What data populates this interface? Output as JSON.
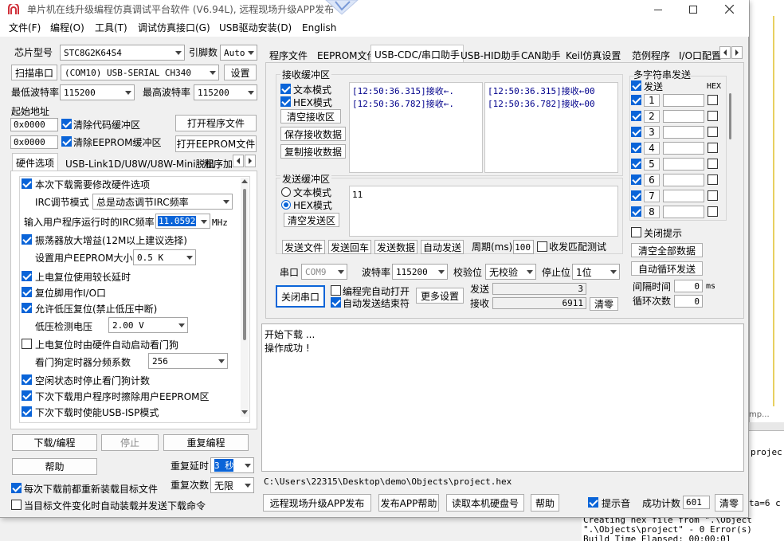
{
  "window": {
    "title": "单片机在线升级编程仿真调试平台软件 (V6.94L), 远程现场升级APP发布",
    "menu": [
      "文件(F)",
      "编程(O)",
      "工具(T)",
      "调试仿真接口(G)",
      "USB驱动安装(D)",
      "English"
    ]
  },
  "left": {
    "chip_label": "芯片型号",
    "chip_value": "STC8G2K64S4",
    "pins_label": "引脚数",
    "pins_value": "Auto",
    "scan_btn": "扫描串口",
    "port_value": "(COM10) USB-SERIAL CH340",
    "settings_btn": "设置",
    "min_baud_label": "最低波特率",
    "min_baud": "115200",
    "max_baud_label": "最高波特率",
    "max_baud": "115200",
    "start_addr_label": "起始地址",
    "addr1": "0x0000",
    "clear_code": "清除代码缓冲区",
    "open_program": "打开程序文件",
    "addr2": "0x0000",
    "clear_eeprom": "清除EEPROM缓冲区",
    "open_eeprom": "打开EEPROM文件",
    "tabs": [
      "硬件选项",
      "USB-Link1D/U8W/U8W-Mini脱机",
      "程序加"
    ],
    "hw": {
      "opt_change": "本次下载需要修改硬件选项",
      "irc_mode_label": "IRC调节模式",
      "irc_mode_value": "总是动态调节IRC频率",
      "freq_label": "输入用户程序运行时的IRC频率",
      "freq_value": "11.0592",
      "freq_unit": "MHz",
      "osc_gain": "振荡器放大增益(12M以上建议选择)",
      "eeprom_size_label": "设置用户EEPROM大小",
      "eeprom_size_value": "0.5 K",
      "poweron_delay": "上电复位使用较长延时",
      "reset_io": "复位脚用作I/O口",
      "lvd_reset": "允许低压复位(禁止低压中断)",
      "lvd_label": "低压检测电压",
      "lvd_value": "2.00 V",
      "wdt_auto": "上电复位时由硬件自动启动看门狗",
      "wdt_div_label": "看门狗定时器分频系数",
      "wdt_div_value": "256",
      "wdt_idle": "空闲状态时停止看门狗计数",
      "erase_eeprom": "下次下载用户程序时擦除用户EEPROM区",
      "usb_isp": "下次下载时使能USB-ISP模式"
    },
    "download_btn": "下载/编程",
    "stop_btn": "停止",
    "reprogram_btn": "重复编程",
    "help_btn": "帮助",
    "repeat_delay_label": "重复延时",
    "repeat_delay_value": "3 秒",
    "repeat_count_label": "重复次数",
    "repeat_count_value": "无限",
    "reload_before": "每次下载前都重新装载目标文件",
    "auto_send_cmd": "当目标文件变化时自动装载并发送下载命令"
  },
  "right": {
    "tabs": [
      "程序文件",
      "EEPROM文件",
      "USB-CDC/串口助手",
      "USB-HID助手",
      "CAN助手",
      "Keil仿真设置",
      "范例程序",
      "I/O口配置"
    ],
    "recv_group": "接收缓冲区",
    "text_mode": "文本模式",
    "hex_mode": "HEX模式",
    "clear_recv": "清空接收区",
    "save_recv": "保存接收数据",
    "copy_recv": "复制接收数据",
    "recv_text_lines": [
      "[12:50:36.315]接收←.",
      "[12:50:36.782]接收←."
    ],
    "recv_hex_lines": [
      "[12:50:36.315]接收←00",
      "[12:50:36.782]接收←00"
    ],
    "send_group": "发送缓冲区",
    "send_text_mode": "文本模式",
    "send_hex_mode": "HEX模式",
    "clear_send": "清空发送区",
    "send_content": "11",
    "send_file": "发送文件",
    "send_return": "发送回车",
    "send_data": "发送数据",
    "auto_send": "自动发送",
    "period_label": "周期(ms)",
    "period_value": "100",
    "match_test": "收发匹配测试",
    "port_label": "串口",
    "port_value": "COM9",
    "baud_label": "波特率",
    "baud_value": "115200",
    "parity_label": "校验位",
    "parity_value": "无校验",
    "stopbit_label": "停止位",
    "stopbit_value": "1位",
    "close_port": "关闭串口",
    "auto_open": "编程完自动打开",
    "auto_end": "自动发送结束符",
    "more_settings": "更多设置",
    "send_count_label": "发送",
    "send_count": "3",
    "recv_count_label": "接收",
    "recv_count": "6911",
    "clear_count": "清零",
    "multi_title": "多字符串发送",
    "multi_send_col": "发送",
    "multi_hex_col": "HEX",
    "multi_rows": [
      "1",
      "2",
      "3",
      "4",
      "5",
      "6",
      "7",
      "8"
    ],
    "close_tips": "关闭提示",
    "clear_all": "清空全部数据",
    "auto_loop": "自动循环发送",
    "interval_label": "间隔时间",
    "interval_value": "0",
    "interval_unit": "ms",
    "loop_label": "循环次数",
    "loop_value": "0"
  },
  "output": {
    "lines": [
      "开始下载 ...",
      "操作成功 !"
    ],
    "path": "C:\\Users\\22315\\Desktop\\demo\\Objects\\project.hex",
    "remote_btn": "远程现场升级APP发布",
    "publish_help": "发布APP帮助",
    "read_disk": "读取本机硬盘号",
    "help": "帮助",
    "beep": "提示音",
    "success_label": "成功计数",
    "success_value": "601",
    "clear": "清零"
  },
  "background": {
    "right_lines": [
      "projec",
      "ta=6 c",
      "Creating hex file from \".\\Object",
      "\".\\Objects\\project\" - 0 Error(s)",
      "Build Time Elapsed:  00:00:01"
    ],
    "tab_hint": "mp..."
  }
}
